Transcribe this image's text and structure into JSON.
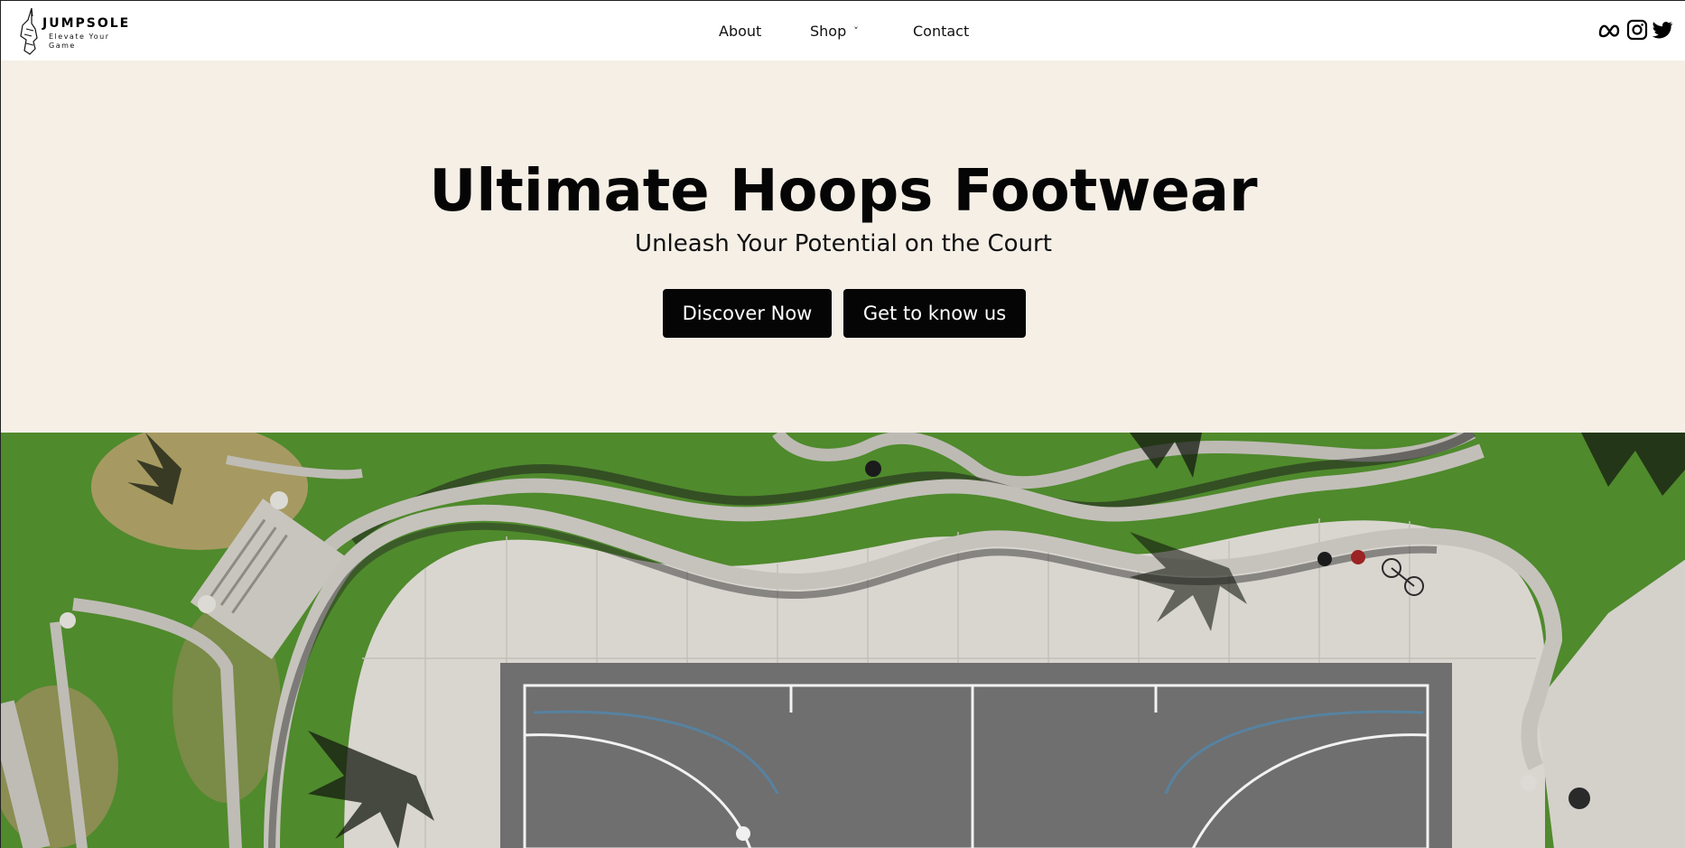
{
  "brand": {
    "name": "JUMPSOLE",
    "tagline": "Elevate Your Game"
  },
  "nav": {
    "about": "About",
    "shop": "Shop",
    "shop_chevron": "˅",
    "contact": "Contact"
  },
  "socials": [
    "meta-icon",
    "instagram-icon",
    "twitter-icon"
  ],
  "hero": {
    "title": "Ultimate Hoops Footwear",
    "subtitle": "Unleash Your Potential on the Court",
    "primary_button": "Discover Now",
    "secondary_button": "Get to know us"
  },
  "colors": {
    "hero_background": "#f5efe6",
    "button_background": "#050505",
    "button_text": "#ffffff",
    "grass": "#4f8a2c",
    "concrete": "#d8d5cf",
    "court": "#6e6e6e"
  }
}
